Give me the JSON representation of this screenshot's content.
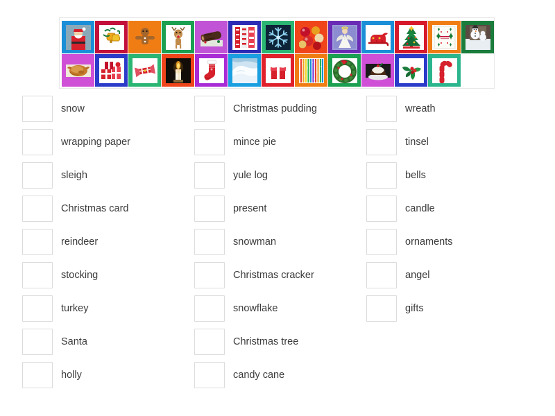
{
  "activity": {
    "type": "match-up-drag-and-drop",
    "theme": "Christmas vocabulary"
  },
  "tile_tray": {
    "name": "image-tile-tray",
    "rows": [
      [
        {
          "name": "santa",
          "border": "#1a8fd8",
          "bg": "#1a8fd8",
          "icon": "santa-icon"
        },
        {
          "name": "bells",
          "border": "#c2103a",
          "bg": "#ffffff",
          "icon": "bells-icon"
        },
        {
          "name": "gingerbread",
          "border": "#f07d14",
          "bg": "#f07d14",
          "icon": "gingerbread-icon"
        },
        {
          "name": "reindeer",
          "border": "#1aa050",
          "bg": "#ffffff",
          "icon": "reindeer-icon"
        },
        {
          "name": "yule-log",
          "border": "#c154d6",
          "bg": "#c154d6",
          "icon": "yule-log-icon"
        },
        {
          "name": "wrapping-paper",
          "border": "#2b2bb5",
          "bg": "#ffffff",
          "icon": "wrapping-paper-icon"
        },
        {
          "name": "snowflake",
          "border": "#2bb573",
          "bg": "#0d2438",
          "icon": "snowflake-icon"
        },
        {
          "name": "ornaments",
          "border": "#f0441a",
          "bg": "#f0441a",
          "icon": "ornaments-icon"
        },
        {
          "name": "angel",
          "border": "#6a2bb5",
          "bg": "#8c8cd6",
          "icon": "angel-icon"
        },
        {
          "name": "sleigh",
          "border": "#1a8fd8",
          "bg": "#ffffff",
          "icon": "sleigh-icon"
        },
        {
          "name": "christmas-tree",
          "border": "#d61a2b",
          "bg": "#ffffff",
          "icon": "christmas-tree-icon"
        },
        {
          "name": "christmas-card",
          "border": "#f07d14",
          "bg": "#ffffff",
          "icon": "christmas-card-icon"
        },
        {
          "name": "snowman",
          "border": "#1a7d3c",
          "bg": "#1a7d3c",
          "icon": "snowman-icon"
        }
      ],
      [
        {
          "name": "turkey",
          "border": "#cf4fd6",
          "bg": "#cf4fd6",
          "icon": "turkey-icon"
        },
        {
          "name": "presents",
          "border": "#2b3bc9",
          "bg": "#ffffff",
          "icon": "presents-icon"
        },
        {
          "name": "christmas-cracker",
          "border": "#2bb573",
          "bg": "#ffffff",
          "icon": "christmas-cracker-icon"
        },
        {
          "name": "candle",
          "border": "#f0441a",
          "bg": "#120d08",
          "icon": "candle-icon"
        },
        {
          "name": "stocking",
          "border": "#a82bd6",
          "bg": "#ffffff",
          "icon": "stocking-icon"
        },
        {
          "name": "snow",
          "border": "#1a9fe0",
          "bg": "#dfeaf2",
          "icon": "snow-icon"
        },
        {
          "name": "present",
          "border": "#e0202b",
          "bg": "#ffffff",
          "icon": "present-icon"
        },
        {
          "name": "tinsel",
          "border": "#f07d14",
          "bg": "#ffffff",
          "icon": "tinsel-icon"
        },
        {
          "name": "wreath",
          "border": "#1aa050",
          "bg": "#ffffff",
          "icon": "wreath-icon"
        },
        {
          "name": "christmas-pudding",
          "border": "#cf4fd6",
          "bg": "#cf4fd6",
          "icon": "christmas-pudding-icon"
        },
        {
          "name": "holly",
          "border": "#2b3bc9",
          "bg": "#ffffff",
          "icon": "holly-icon"
        },
        {
          "name": "candy-cane",
          "border": "#2bb58c",
          "bg": "#ffffff",
          "icon": "candy-cane-icon"
        },
        {
          "name": "empty-slot",
          "border": "transparent",
          "bg": "transparent",
          "icon": "none"
        }
      ]
    ]
  },
  "answers": {
    "columns": [
      {
        "items": [
          {
            "label": "snow"
          },
          {
            "label": "wrapping paper"
          },
          {
            "label": "sleigh"
          },
          {
            "label": "Christmas card"
          },
          {
            "label": "reindeer"
          },
          {
            "label": "stocking"
          },
          {
            "label": "turkey"
          },
          {
            "label": "Santa"
          },
          {
            "label": "holly"
          }
        ]
      },
      {
        "items": [
          {
            "label": "Christmas pudding"
          },
          {
            "label": "mince pie"
          },
          {
            "label": "yule log"
          },
          {
            "label": "present"
          },
          {
            "label": "snowman"
          },
          {
            "label": "Christmas cracker"
          },
          {
            "label": "snowflake"
          },
          {
            "label": "Christmas tree"
          },
          {
            "label": "candy cane"
          }
        ]
      },
      {
        "items": [
          {
            "label": "wreath"
          },
          {
            "label": "tinsel"
          },
          {
            "label": "bells"
          },
          {
            "label": "candle"
          },
          {
            "label": "ornaments"
          },
          {
            "label": "angel"
          },
          {
            "label": "gifts"
          }
        ]
      }
    ]
  },
  "colors": {
    "page_background": "#ffffff",
    "tray_border": "#e8e8e8",
    "drop_box_border": "#dcdcdc",
    "label_text": "#3b3b3b"
  }
}
